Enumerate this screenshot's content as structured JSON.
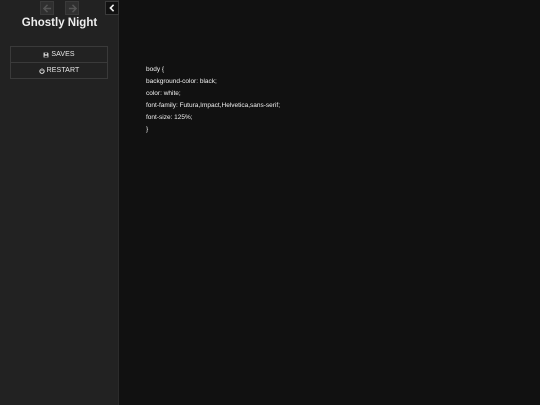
{
  "sidebar": {
    "title": "Ghostly Night",
    "history": {
      "back_icon": "arrow-left-icon",
      "forward_icon": "arrow-right-icon"
    },
    "toggle_icon": "chevron-left-icon",
    "menu": [
      {
        "label": "SAVES",
        "icon": "floppy-disk-icon"
      },
      {
        "label": "RESTART",
        "icon": "power-icon"
      }
    ]
  },
  "passage": {
    "lines": [
      "body {",
      "background-color: black;",
      "color: white;",
      "font-family: Futura,Impact,Helvetica,sans-serif;",
      "font-size: 125%;",
      "}"
    ]
  },
  "colors": {
    "sidebar_bg": "#222222",
    "main_bg": "#111111",
    "text": "#eeeeee",
    "border": "#3a3a3a"
  }
}
